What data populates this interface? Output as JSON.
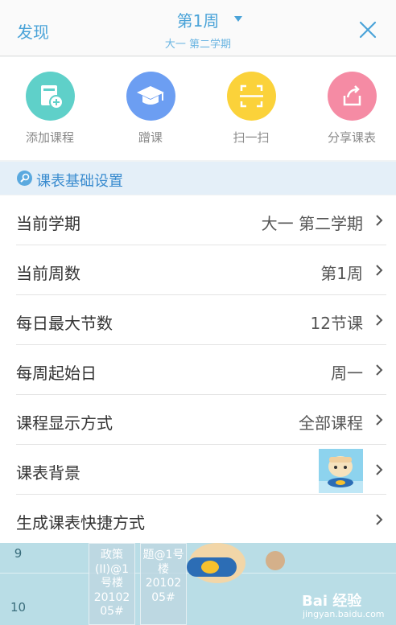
{
  "header": {
    "left_label": "发现",
    "week_title": "第1周",
    "term_subtitle": "大一  第二学期"
  },
  "quick_actions": [
    {
      "label": "添加课程",
      "icon": "add-course-icon",
      "color": "#5fd0c9"
    },
    {
      "label": "蹭课",
      "icon": "graduation-cap-icon",
      "color": "#6c9ef2"
    },
    {
      "label": "扫一扫",
      "icon": "scan-icon",
      "color": "#fbd23a"
    },
    {
      "label": "分享课表",
      "icon": "share-icon",
      "color": "#f58ba4"
    }
  ],
  "section": {
    "title": "课表基础设置"
  },
  "settings": [
    {
      "label": "当前学期",
      "value": "大一  第二学期"
    },
    {
      "label": "当前周数",
      "value": "第1周"
    },
    {
      "label": "每日最大节数",
      "value": "12节课"
    },
    {
      "label": "每周起始日",
      "value": "周一"
    },
    {
      "label": "课程显示方式",
      "value": "全部课程"
    },
    {
      "label": "课表背景",
      "value": ""
    },
    {
      "label": "生成课表快捷方式",
      "value": ""
    }
  ],
  "background_schedule": {
    "row_numbers": [
      "9",
      "10"
    ],
    "cards": [
      [
        "政策",
        "(II)@1",
        "号楼",
        "20102",
        "05#"
      ],
      [
        "题@1号",
        "楼",
        "20102",
        "05#"
      ]
    ]
  },
  "watermark": {
    "brand": "Bai 经验",
    "site": "jingyan.baidu.com"
  },
  "colors": {
    "accent": "#4aa3d8",
    "section_bg": "#e4eff8"
  }
}
